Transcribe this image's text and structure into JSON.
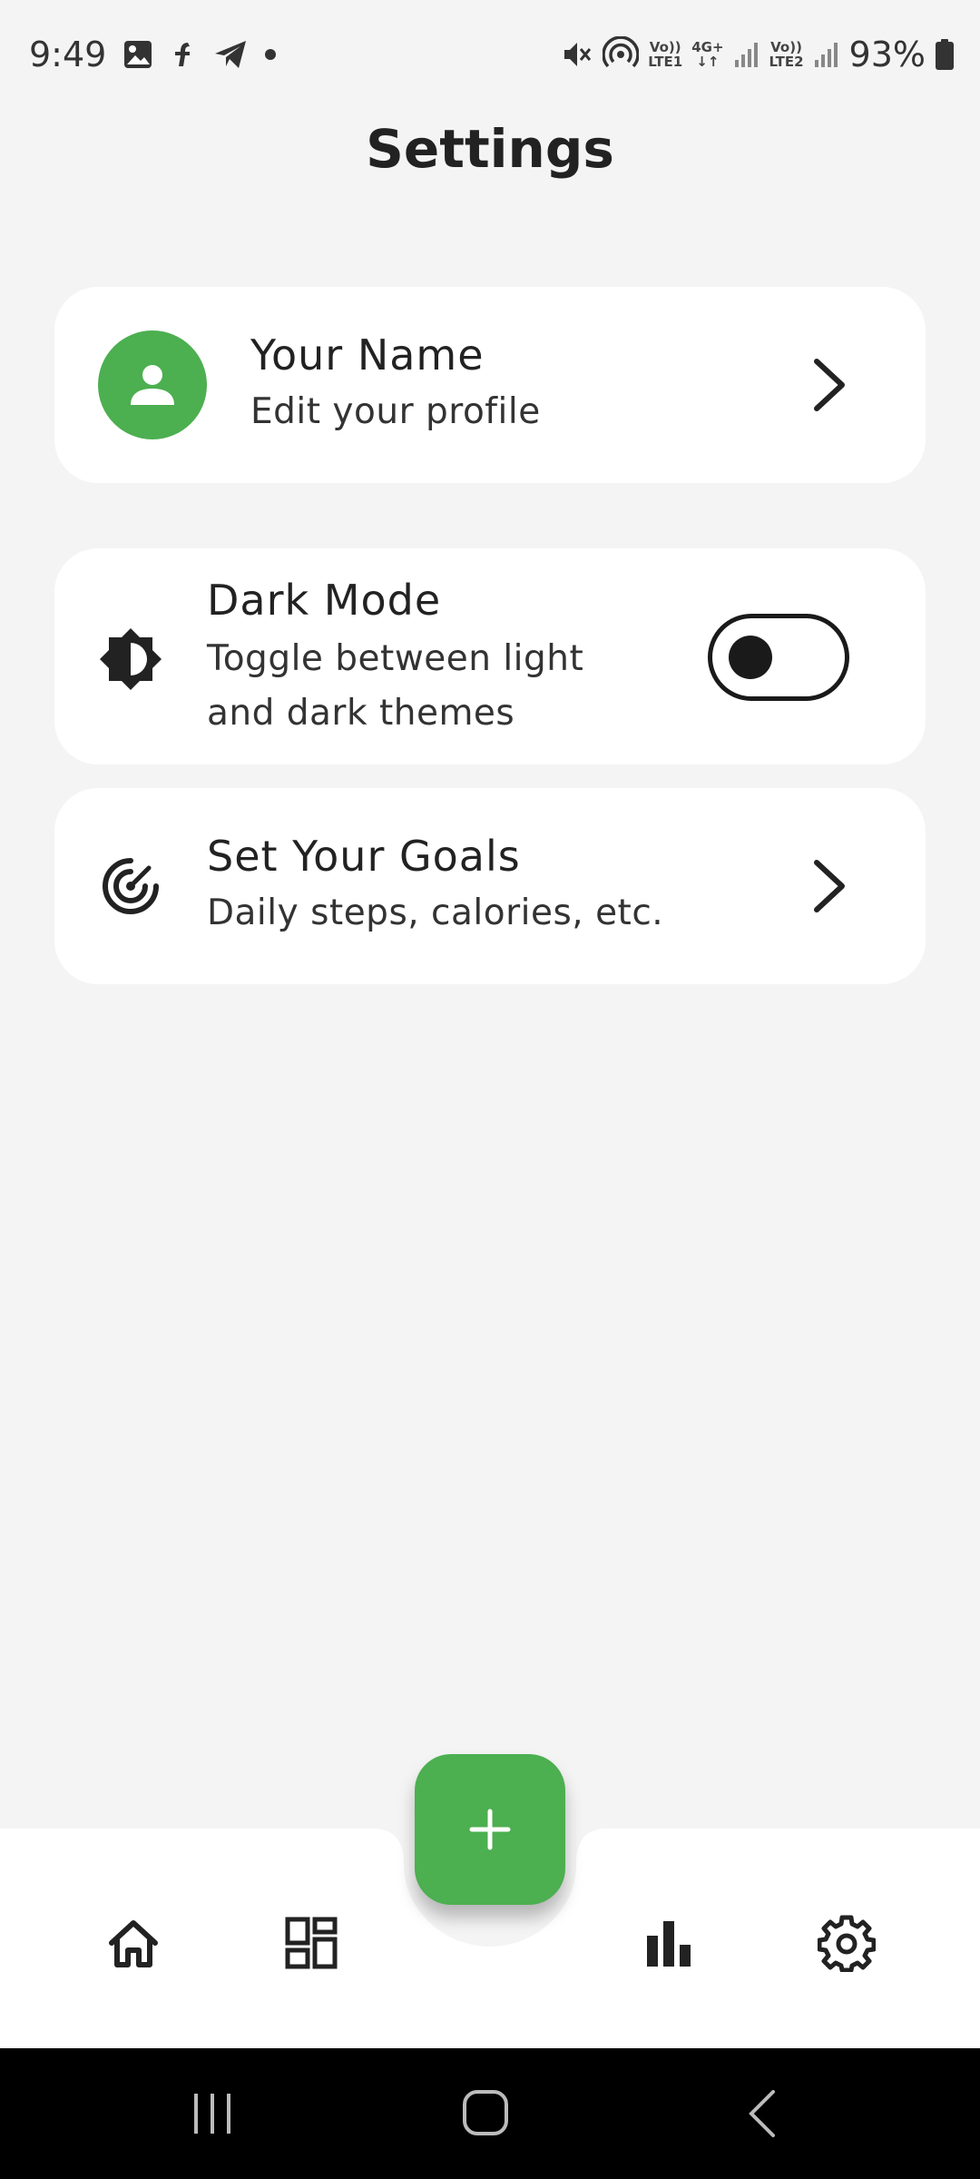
{
  "status_bar": {
    "time": "9:49",
    "lte1_top": "Vo))",
    "lte1_bottom": "LTE1",
    "net_4g": "4G+",
    "lte2_top": "Vo))",
    "lte2_bottom": "LTE2",
    "battery": "93%"
  },
  "page": {
    "title": "Settings"
  },
  "profile": {
    "name": "Your Name",
    "subtitle": "Edit your profile"
  },
  "dark_mode": {
    "title": "Dark Mode",
    "subtitle_line1": "Toggle between light",
    "subtitle_line2": "and dark themes",
    "enabled": false
  },
  "goals": {
    "title": "Set Your Goals",
    "subtitle": "Daily steps, calories, etc."
  },
  "bottom_nav": {
    "items": [
      "home-icon",
      "dashboard-icon",
      "stats-icon",
      "settings-icon"
    ],
    "fab_icon": "plus-icon"
  },
  "colors": {
    "accent": "#4caf50",
    "background": "#f4f4f4",
    "card": "#ffffff"
  }
}
